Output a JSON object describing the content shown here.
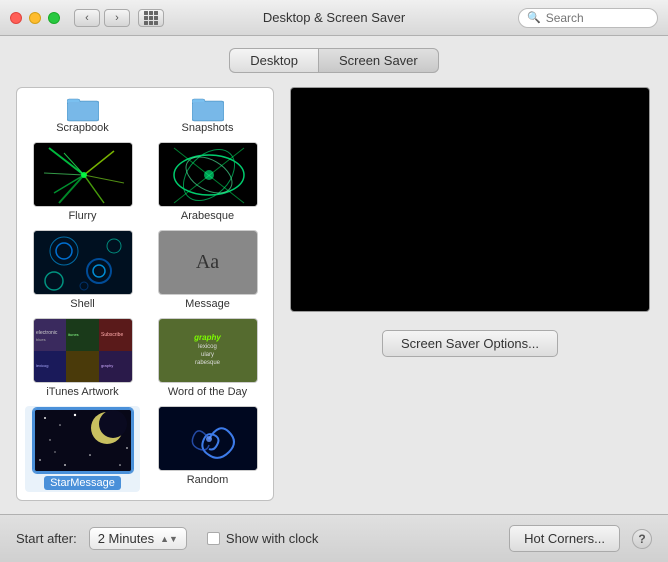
{
  "window": {
    "title": "Desktop & Screen Saver"
  },
  "search": {
    "placeholder": "Search"
  },
  "tabs": {
    "desktop": "Desktop",
    "screen_saver": "Screen Saver",
    "active": "screen_saver"
  },
  "folders": [
    {
      "id": "scrapbook",
      "label": "Scrapbook"
    },
    {
      "id": "snapshots",
      "label": "Snapshots"
    }
  ],
  "screen_savers": [
    {
      "id": "flurry",
      "label": "Flurry",
      "selected": false
    },
    {
      "id": "arabesque",
      "label": "Arabesque",
      "selected": false
    },
    {
      "id": "shell",
      "label": "Shell",
      "selected": false
    },
    {
      "id": "message",
      "label": "Message",
      "selected": false
    },
    {
      "id": "itunes-artwork",
      "label": "iTunes Artwork",
      "selected": false
    },
    {
      "id": "word-of-day",
      "label": "Word of the Day",
      "selected": false
    },
    {
      "id": "starmessage",
      "label": "StarMessage",
      "selected": true
    },
    {
      "id": "random",
      "label": "Random",
      "selected": false
    }
  ],
  "preview": {
    "options_button": "Screen Saver Options..."
  },
  "bottom_bar": {
    "start_after_label": "Start after:",
    "time_value": "2 Minutes",
    "show_clock_label": "Show with clock",
    "hot_corners_button": "Hot Corners...",
    "help_label": "?"
  }
}
